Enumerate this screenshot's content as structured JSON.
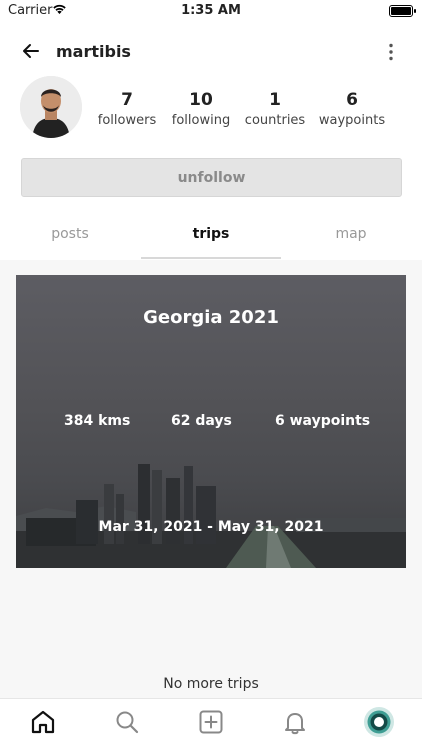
{
  "status_bar": {
    "carrier": "Carrier",
    "time": "1:35 AM"
  },
  "header": {
    "username": "martibis"
  },
  "profile": {
    "stats": [
      {
        "value": "7",
        "label": "followers"
      },
      {
        "value": "10",
        "label": "following"
      },
      {
        "value": "1",
        "label": "countries"
      },
      {
        "value": "6",
        "label": "waypoints"
      }
    ],
    "unfollow_label": "unfollow"
  },
  "tabs": [
    {
      "label": "posts",
      "active": false
    },
    {
      "label": "trips",
      "active": true
    },
    {
      "label": "map",
      "active": false
    }
  ],
  "trip": {
    "title": "Georgia 2021",
    "distance": "384 kms",
    "duration": "62 days",
    "waypoints": "6 waypoints",
    "dates": "Mar 31, 2021 - May 31, 2021"
  },
  "footer_text": "No more trips",
  "bottom_nav": [
    "home-icon",
    "search-icon",
    "add-post-icon",
    "bell-icon",
    "profile-icon"
  ]
}
